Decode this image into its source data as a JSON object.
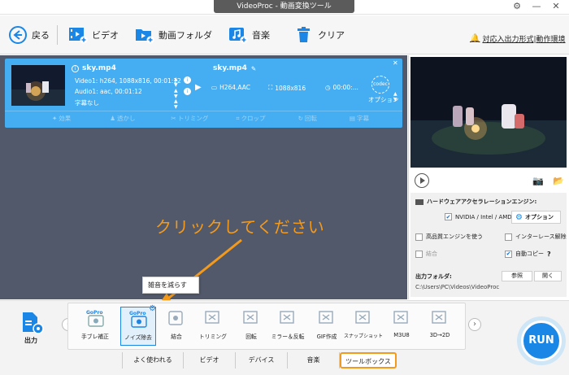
{
  "window": {
    "title": "VideoProc - 動画変換ツール"
  },
  "toolbar": {
    "back_label": "戻る",
    "video_label": "ビデオ",
    "folder_label": "動画フォルダ",
    "music_label": "音楽",
    "clear_label": "クリア",
    "notice_label": "対応入出力形式|動作環境"
  },
  "task": {
    "source_name": "sky.mp4",
    "video_info": "Video1: h264, 1088x816, 00:01:12",
    "audio_info": "Audio1: aac, 00:01:12",
    "subtitle_info": "字幕なし",
    "output_name": "sky.mp4",
    "codec": "H264,AAC",
    "resolution": "1088x816",
    "duration": "00:00:...",
    "codec_badge": "codec",
    "option_label": "オプション",
    "footer": {
      "effects": "効果",
      "watermark": "透かし",
      "trim": "トリミング",
      "crop": "クロップ",
      "rotate": "回転",
      "subtitle": "字幕"
    }
  },
  "hardware": {
    "title": "ハードウェアアクセラレーションエンジン:",
    "gpu_label": "NVIDIA / Intel / AMD",
    "option_button": "オプション",
    "hq_engine": "高品質エンジンを使う",
    "deinterlace": "インターレース解除",
    "merge": "結合",
    "auto_copy": "自動コピー",
    "help_glyph": "?",
    "gpu_checked": true,
    "hq_checked": false,
    "deinterlace_checked": false,
    "merge_checked": false,
    "auto_copy_checked": true
  },
  "output": {
    "folder_label": "出力フォルダ:",
    "folder_path": "C:\\Users\\PC\\Videos\\VideoProc",
    "browse_button": "参照",
    "open_button": "開く",
    "side_label": "出力"
  },
  "annotation": {
    "callout": "クリックしてください",
    "tooltip": "雑音を減らす"
  },
  "tools": [
    {
      "label": "手ブレ補正",
      "badge": "GoPro"
    },
    {
      "label": "ノイズ除去",
      "badge": "GoPro"
    },
    {
      "label": "結合"
    },
    {
      "label": "トリミング"
    },
    {
      "label": "回転"
    },
    {
      "label": "ミラー＆反転"
    },
    {
      "label": "GIF作成"
    },
    {
      "label": "スナップショット"
    },
    {
      "label": "M3U8"
    },
    {
      "label": "3D→2D"
    }
  ],
  "tabs": [
    "よく使われる",
    "ビデオ",
    "デバイス",
    "音楽",
    "ツールボックス"
  ],
  "active_tab": "ツールボックス",
  "run_label": "RUN",
  "colors": {
    "accent": "#1a86e6",
    "card": "#45aef2",
    "callout": "#f39a1d",
    "panel": "#52596b"
  }
}
